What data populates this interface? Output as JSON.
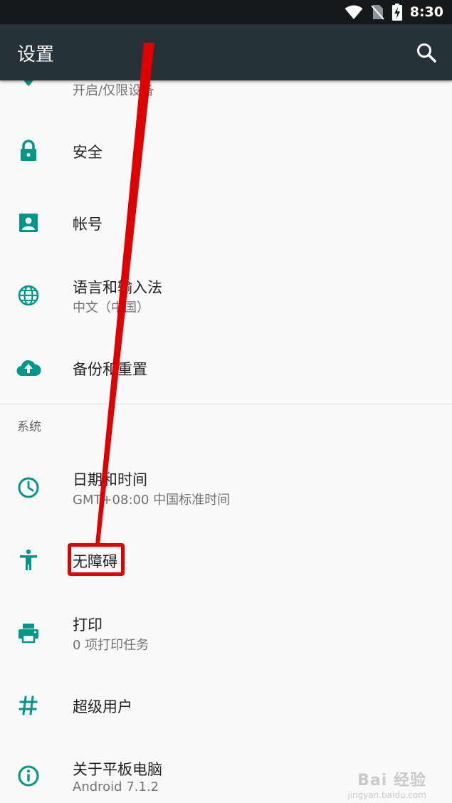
{
  "status_bar": {
    "time": "8:30",
    "icons": [
      "wifi-icon",
      "no-sim-icon",
      "battery-charging-icon"
    ]
  },
  "app_bar": {
    "title": "设置",
    "search_icon": "search-icon"
  },
  "items": [
    {
      "title": "",
      "subtitle": "开启/仅限设备",
      "icon": "location-icon"
    },
    {
      "title": "安全",
      "subtitle": "",
      "icon": "lock-icon"
    },
    {
      "title": "帐号",
      "subtitle": "",
      "icon": "account-box-icon"
    },
    {
      "title": "语言和输入法",
      "subtitle": "中文（中国）",
      "icon": "globe-icon"
    },
    {
      "title": "备份和重置",
      "subtitle": "",
      "icon": "cloud-upload-icon"
    }
  ],
  "section_header": "系统",
  "system_items": [
    {
      "title": "日期和时间",
      "subtitle": "GMT+08:00 中国标准时间",
      "icon": "clock-icon"
    },
    {
      "title": "无障碍",
      "subtitle": "",
      "icon": "accessibility-icon"
    },
    {
      "title": "打印",
      "subtitle": "0 项打印任务",
      "icon": "print-icon"
    },
    {
      "title": "超级用户",
      "subtitle": "",
      "icon": "hash-icon"
    },
    {
      "title": "关于平板电脑",
      "subtitle": "Android 7.1.2",
      "icon": "info-icon"
    }
  ],
  "watermark": {
    "brand": "Bai 经验",
    "url": "jingyan.baidu.com"
  },
  "colors": {
    "accent": "#009688",
    "appbar": "#263238",
    "statusbar": "#15191c",
    "annotation": "#e00000"
  }
}
